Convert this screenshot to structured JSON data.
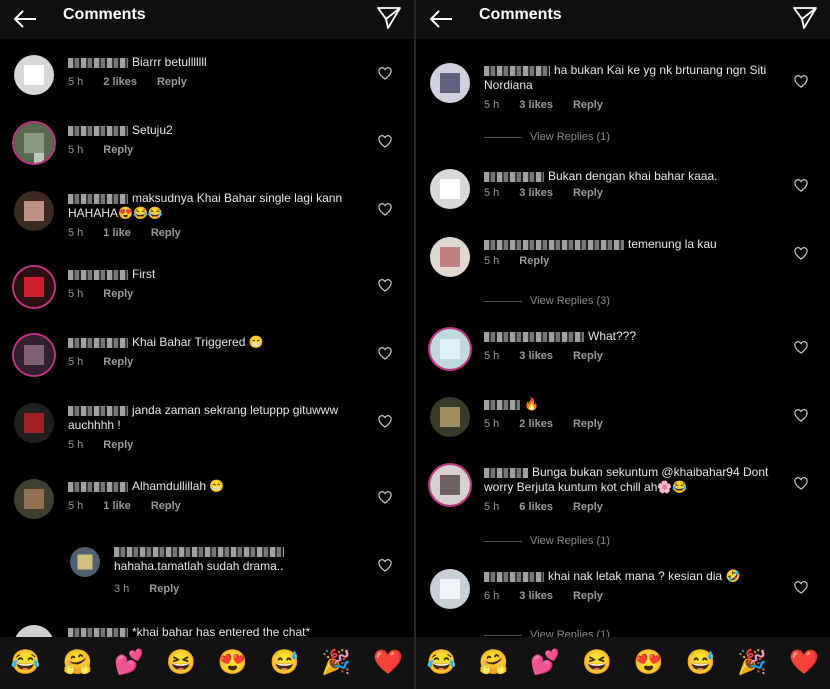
{
  "left": {
    "title": "Comments",
    "comments": [
      {
        "text": "Biarrr betulllllll",
        "time": "5 h",
        "likes": "2 likes",
        "reply": "Reply"
      },
      {
        "text": "Setuju2",
        "time": "5 h",
        "likes": "",
        "reply": "Reply"
      },
      {
        "text": "maksudnya Khai Bahar single lagi kann HAHAHA😍😂😂",
        "time": "5 h",
        "likes": "1 like",
        "reply": "Reply"
      },
      {
        "text": "First",
        "time": "5 h",
        "likes": "",
        "reply": "Reply"
      },
      {
        "text": "Khai Bahar Triggered 😁",
        "time": "5 h",
        "likes": "",
        "reply": "Reply"
      },
      {
        "text": "janda zaman sekrang letuppp gituwww auchhhh !",
        "time": "5 h",
        "likes": "",
        "reply": "Reply"
      },
      {
        "text": "Alhamdullillah 😁",
        "time": "5 h",
        "likes": "1 like",
        "reply": "Reply"
      },
      {
        "text": "hahaha.tamatlah sudah drama..",
        "time": "3 h",
        "likes": "",
        "reply": "Reply"
      },
      {
        "text": "*khai bahar has entered the chat*",
        "time": "",
        "likes": "",
        "reply": ""
      }
    ]
  },
  "right": {
    "title": "Comments",
    "comments": [
      {
        "text": "ha bukan Kai ke yg nk brtunang ngn Siti Nordiana",
        "time": "5 h",
        "likes": "3 likes",
        "reply": "Reply"
      },
      {
        "text": "Bukan dengan khai bahar kaaa.",
        "time": "5 h",
        "likes": "3 likes",
        "reply": "Reply"
      },
      {
        "text": "temenung la kau",
        "time": "5 h",
        "likes": "",
        "reply": "Reply"
      },
      {
        "text": "What???",
        "time": "5 h",
        "likes": "3 likes",
        "reply": "Reply"
      },
      {
        "text": "🔥",
        "time": "5 h",
        "likes": "2 likes",
        "reply": "Reply"
      },
      {
        "text": "Bunga bukan sekuntum @khaibahar94 Dont worry Berjuta kuntum kot chill ah🌸😂",
        "time": "5 h",
        "likes": "6 likes",
        "reply": "Reply"
      },
      {
        "text": "khai nak letak mana ? kesian dia 🤣",
        "time": "6 h",
        "likes": "3 likes",
        "reply": "Reply"
      }
    ],
    "view_replies": [
      "View Replies (1)",
      "View Replies (3)",
      "View Replies (1)",
      "View Replies (1)"
    ]
  },
  "emoji_bar": [
    "😂",
    "🤗",
    "💕",
    "😆",
    "😍",
    "😅",
    "🎉",
    "❤️"
  ],
  "colors": {
    "background": "#000000",
    "topbar": "#101010",
    "ring": "#c13584",
    "emoji_bar": "#121212"
  }
}
